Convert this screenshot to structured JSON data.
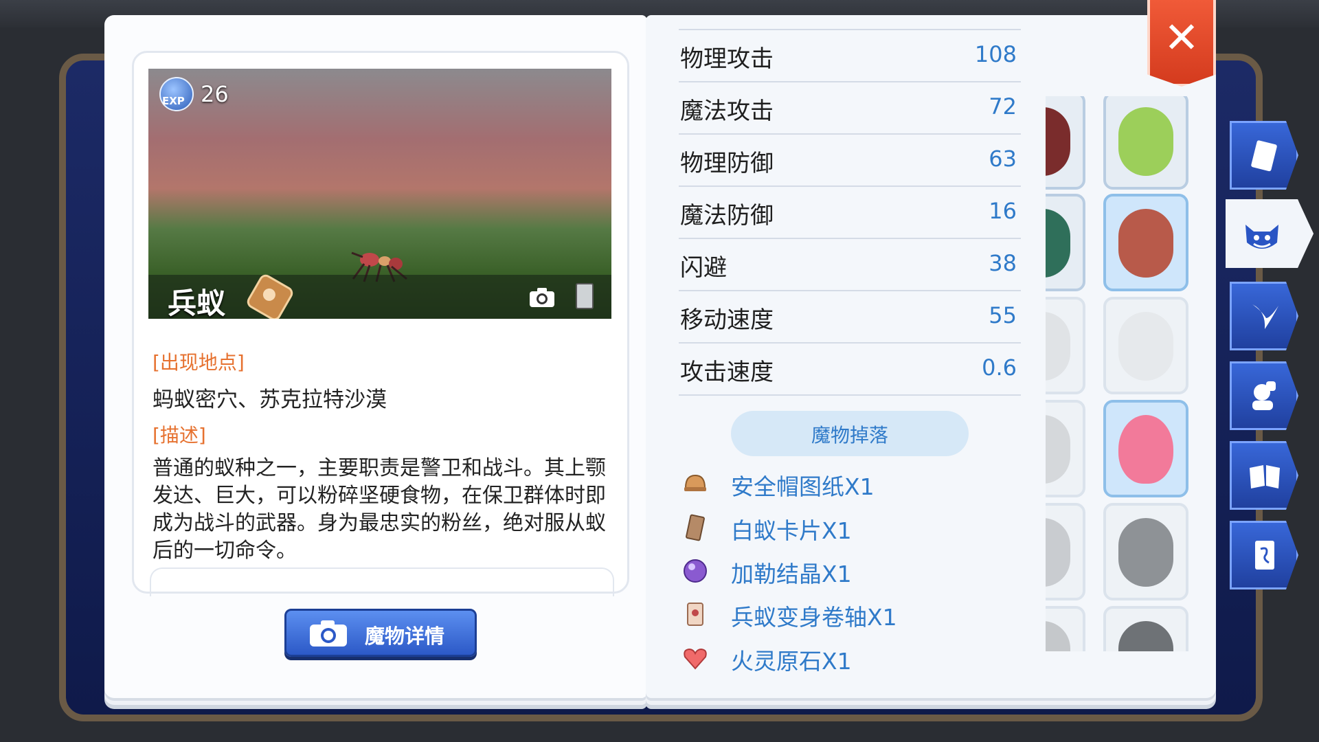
{
  "monster": {
    "exp_label": "EXP",
    "exp_value": "26",
    "name": "兵蚁"
  },
  "info": {
    "location_title": "[出现地点]",
    "location_text": "蚂蚁密穴、苏克拉特沙漠",
    "desc_title": "[描述]",
    "desc_text": "普通的蚁种之一，主要职责是警卫和战斗。其上颚发达、巨大，可以粉碎坚硬食物，在保卫群体时即成为战斗的武器。身为最忠实的粉丝，绝对服从蚁后的一切命令。"
  },
  "buttons": {
    "detail_label": "魔物详情",
    "close_label": "✕"
  },
  "stats": [
    {
      "label": "物理攻击",
      "value": "108"
    },
    {
      "label": "魔法攻击",
      "value": "72"
    },
    {
      "label": "物理防御",
      "value": "63"
    },
    {
      "label": "魔法防御",
      "value": "16"
    },
    {
      "label": "闪避",
      "value": "38"
    },
    {
      "label": "移动速度",
      "value": "55"
    },
    {
      "label": "攻击速度",
      "value": "0.6"
    }
  ],
  "drops": {
    "title": "魔物掉落",
    "items": [
      {
        "label": "安全帽图纸X1",
        "icon": "helmet-blueprint-icon"
      },
      {
        "label": "白蚁卡片X1",
        "icon": "card-icon"
      },
      {
        "label": "加勒结晶X1",
        "icon": "crystal-icon"
      },
      {
        "label": "兵蚁变身卷轴X1",
        "icon": "scroll-icon"
      },
      {
        "label": "火灵原石X1",
        "icon": "heart-stone-icon"
      }
    ]
  },
  "colors": {
    "accent_blue": "#2f7ac9",
    "section_orange": "#e6712f",
    "close_red": "#e04a2a"
  }
}
